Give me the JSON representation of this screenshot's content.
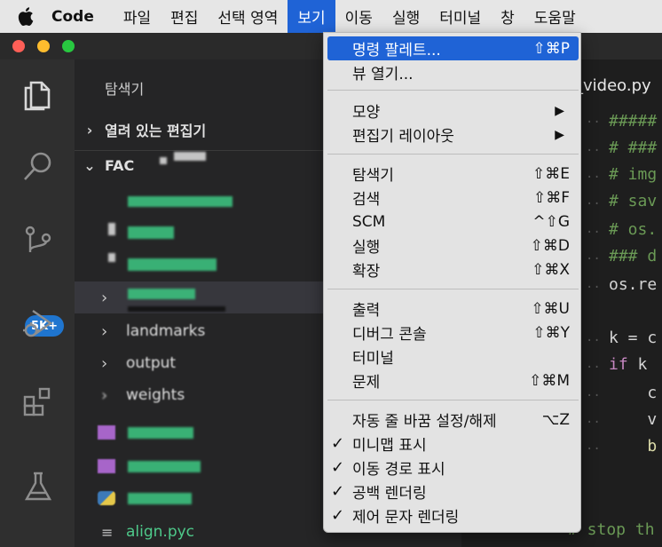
{
  "menubar": {
    "app_name": "Code",
    "items": [
      "파일",
      "편집",
      "선택 영역",
      "보기",
      "이동",
      "실행",
      "터미널",
      "창",
      "도움말"
    ],
    "active_index": 3
  },
  "colors": {
    "menu_highlight": "#1f63d6",
    "badge": "#1f75cf",
    "sidebar": "#252526",
    "editor": "#1e1e1e"
  },
  "activity_bar": {
    "icons": [
      "explorer-icon",
      "search-icon",
      "source-control-icon",
      "run-debug-icon",
      "extensions-icon",
      "testing-icon"
    ],
    "badge": "5K+"
  },
  "sidebar": {
    "title": "탐색기",
    "open_editors": "열려 있는 편집기",
    "folder": "FAC",
    "visible_rows": [
      "landmarks",
      "output",
      "weights"
    ],
    "last_file": "align.pyc"
  },
  "editor": {
    "tab_title": "_video.py",
    "lines": [
      "#####",
      "# ###",
      "# img",
      "# sav",
      "# os.",
      "### d",
      "os.re",
      "",
      "k = c",
      "if k",
      "    c",
      "    v",
      "    b"
    ],
    "footer_comment": "# stop th"
  },
  "view_menu": {
    "items": [
      {
        "label": "명령 팔레트...",
        "shortcut": "⇧⌘P",
        "highlight": true
      },
      {
        "label": "뷰 열기...",
        "shortcut": ""
      },
      {
        "label": "모양",
        "submenu": true
      },
      {
        "label": "편집기 레이아웃",
        "submenu": true
      },
      {
        "label": "탐색기",
        "shortcut": "⇧⌘E"
      },
      {
        "label": "검색",
        "shortcut": "⇧⌘F"
      },
      {
        "label": "SCM",
        "shortcut": "^⇧G"
      },
      {
        "label": "실행",
        "shortcut": "⇧⌘D"
      },
      {
        "label": "확장",
        "shortcut": "⇧⌘X"
      },
      {
        "label": "출력",
        "shortcut": "⇧⌘U"
      },
      {
        "label": "디버그 콘솔",
        "shortcut": "⇧⌘Y"
      },
      {
        "label": "터미널",
        "shortcut": ""
      },
      {
        "label": "문제",
        "shortcut": "⇧⌘M"
      },
      {
        "label": "자동 줄 바꿈 설정/해제",
        "shortcut": "⌥Z"
      },
      {
        "label": "미니맵 표시",
        "checked": true
      },
      {
        "label": "이동 경로 표시",
        "checked": true
      },
      {
        "label": "공백 렌더링",
        "checked": true
      },
      {
        "label": "제어 문자 렌더링",
        "checked": true
      }
    ]
  }
}
